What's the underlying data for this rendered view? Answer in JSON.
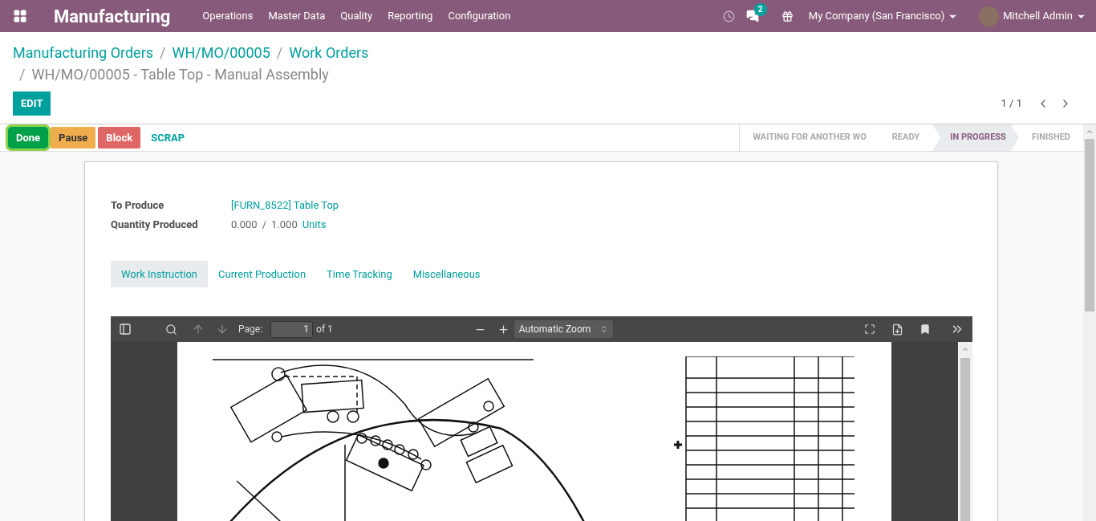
{
  "navbar": {
    "app_name": "Manufacturing",
    "menu": [
      "Operations",
      "Master Data",
      "Quality",
      "Reporting",
      "Configuration"
    ],
    "messages_badge": "2",
    "company": "My Company (San Francisco)",
    "user": "Mitchell Admin"
  },
  "breadcrumb_lines": [
    [
      {
        "kind": "link",
        "text": "Manufacturing Orders"
      },
      {
        "kind": "separator",
        "text": "/"
      },
      {
        "kind": "link",
        "text": "WH/MO/00005"
      },
      {
        "kind": "separator",
        "text": "/"
      },
      {
        "kind": "link",
        "text": "Work Orders"
      }
    ],
    [
      {
        "kind": "separator",
        "text": "/"
      },
      {
        "kind": "current",
        "text": "WH/MO/00005 - Table Top - Manual Assembly"
      }
    ]
  ],
  "edit_button": "EDIT",
  "pager": "1 / 1",
  "actions": [
    {
      "label": "Done",
      "kind": "success",
      "focused": true
    },
    {
      "label": "Pause",
      "kind": "warning",
      "focused": false
    },
    {
      "label": "Block",
      "kind": "danger",
      "focused": false
    },
    {
      "label": "SCRAP",
      "kind": "link",
      "focused": false
    }
  ],
  "status_steps": [
    {
      "label": "WAITING FOR ANOTHER WO",
      "selected": false
    },
    {
      "label": "READY",
      "selected": false
    },
    {
      "label": "IN PROGRESS",
      "selected": true
    },
    {
      "label": "FINISHED",
      "selected": false
    }
  ],
  "fields": [
    {
      "kind": "link",
      "label": "To Produce",
      "value": "[FURN_8522] Table Top"
    },
    {
      "kind": "quantity",
      "label": "Quantity Produced",
      "produced": "0.000",
      "separator": "/",
      "planned": "1.000",
      "unit": "Units"
    }
  ],
  "tabs": [
    {
      "label": "Work Instruction",
      "selected": true
    },
    {
      "label": "Current Production",
      "selected": false
    },
    {
      "label": "Time Tracking",
      "selected": false
    },
    {
      "label": "Miscellaneous",
      "selected": false
    }
  ],
  "pdf_viewer": {
    "page_label": "Page:",
    "page_value": "1",
    "page_count": "of 1",
    "zoom": "Automatic Zoom"
  }
}
